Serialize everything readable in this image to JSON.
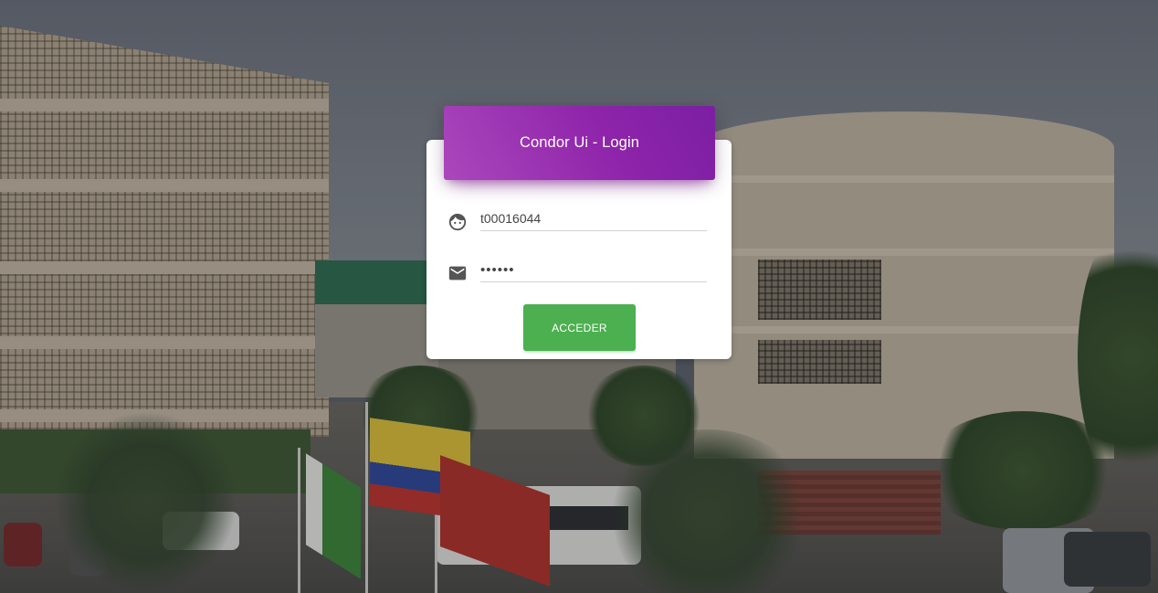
{
  "login": {
    "title": "Condor Ui - Login",
    "username": {
      "value": "t00016044",
      "icon": "face-icon"
    },
    "password": {
      "value": "••••••",
      "icon": "mail-icon"
    },
    "submit_label": "ACCEDER"
  },
  "colors": {
    "header_gradient_start": "#ab47bc",
    "header_gradient_end": "#7b1fa2",
    "button": "#4caf50",
    "card": "#ffffff"
  }
}
